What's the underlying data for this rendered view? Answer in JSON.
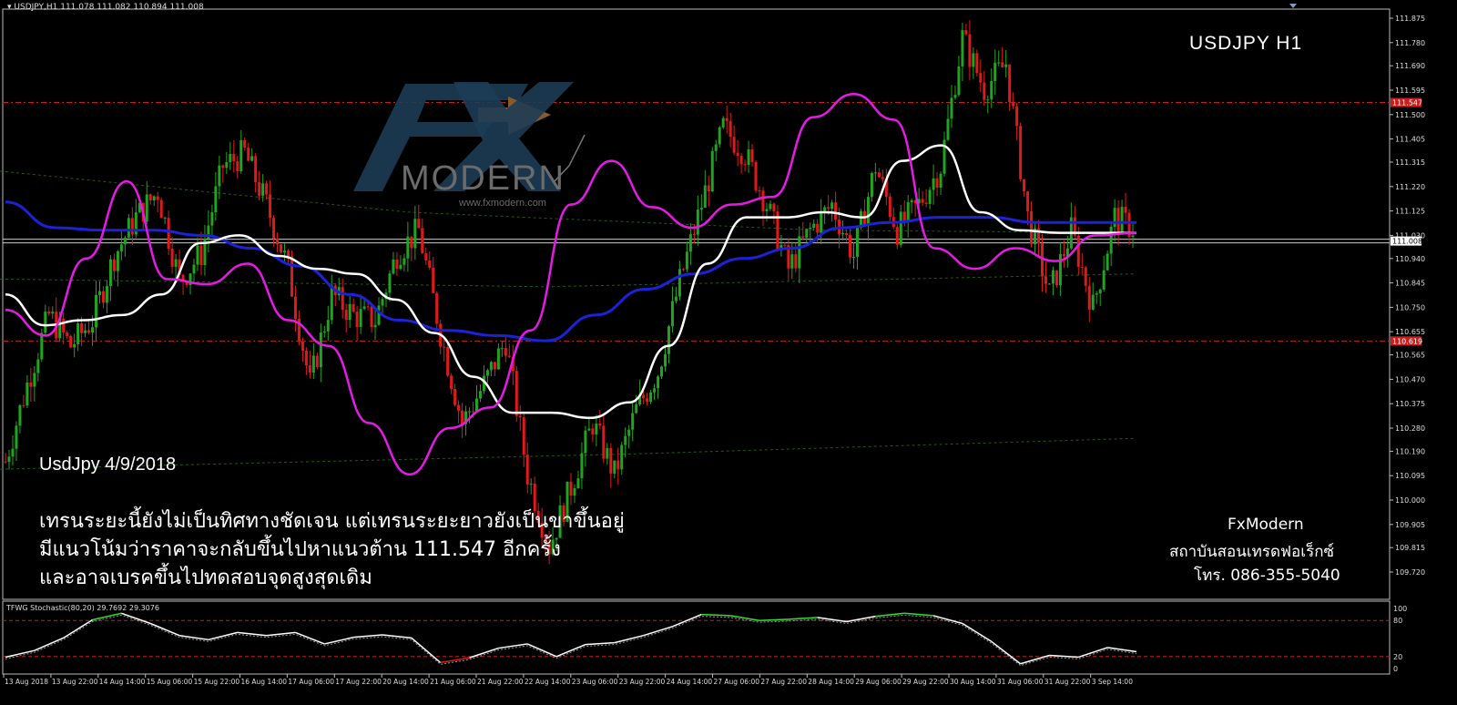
{
  "header": {
    "symbol_line": "USDJPY,H1  111.078 111.082 110.894 111.008",
    "corner_title": "USDJPY H1"
  },
  "annotation": {
    "date": "UsdJpy 4/9/2018",
    "lines": [
      "เทรนระยะนี้ยังไม่เป็นทิศทางชัดเจน แต่เทรนระยะยาวยังเป็นขาขึ้นอยู่",
      "มีแนวโน้มว่าราคาจะกลับขึ้นไปหาแนวต้าน 111.547 อีกครั้ง",
      "และอาจเบรคขึ้นไปทดสอบจุดสูงสุดเดิม"
    ]
  },
  "brand": {
    "name": "FxModern",
    "subtitle": "สถาบันสอนเทรดฟอเร็กซ์",
    "phone": "โทร. 086-355-5040",
    "logo_text": "MODERN",
    "logo_url": "www.fxmodern.com"
  },
  "indicator": {
    "label": "TFWG Stochastic(80,20) 29.7692 29.3076",
    "levels": [
      "100",
      "80",
      "20",
      "0"
    ]
  },
  "colors": {
    "bull": "#1fa51f",
    "bear": "#e01a1a",
    "slow_ma": "#1c22d8",
    "mid_ma": "#ffffff",
    "fast_ma": "#e51be5",
    "level_line": "#c81e1e",
    "stoch_up": "#33dd33",
    "stoch_down": "#e01a1a"
  },
  "chart_data": {
    "type": "line",
    "symbol": "USDJPY",
    "timeframe": "H1",
    "ylim": [
      109.72,
      111.875
    ],
    "y_ticks": [
      "111.875",
      "111.780",
      "111.690",
      "111.595",
      "111.500",
      "111.405",
      "111.315",
      "111.220",
      "111.125",
      "111.030",
      "110.940",
      "110.845",
      "110.750",
      "110.655",
      "110.565",
      "110.470",
      "110.375",
      "110.280",
      "110.190",
      "110.095",
      "110.000",
      "109.905",
      "109.815",
      "109.720"
    ],
    "price_tags": [
      "111.547",
      "110.619",
      "111.008"
    ],
    "x_tick_labels": [
      "13 Aug 2018",
      "13 Aug 22:00",
      "14 Aug 14:00",
      "15 Aug 06:00",
      "15 Aug 22:00",
      "16 Aug 14:00",
      "17 Aug 06:00",
      "17 Aug 22:00",
      "20 Aug 14:00",
      "21 Aug 06:00",
      "21 Aug 22:00",
      "22 Aug 14:00",
      "23 Aug 06:00",
      "23 Aug 22:00",
      "24 Aug 14:00",
      "27 Aug 06:00",
      "27 Aug 22:00",
      "28 Aug 14:00",
      "29 Aug 06:00",
      "29 Aug 22:00",
      "30 Aug 14:00",
      "31 Aug 06:00",
      "31 Aug 22:00",
      "3 Sep 14:00"
    ],
    "levels": [
      111.547,
      110.619
    ],
    "last_price": 111.008,
    "candle_close_path": [
      110.15,
      110.45,
      110.72,
      110.6,
      110.7,
      110.95,
      111.1,
      111.2,
      110.85,
      110.96,
      111.3,
      111.35,
      111.15,
      110.9,
      110.45,
      110.8,
      110.72,
      110.7,
      110.96,
      111.05,
      110.65,
      110.3,
      110.45,
      110.62,
      110.1,
      109.82,
      110.05,
      110.3,
      110.1,
      110.35,
      110.5,
      110.85,
      111.15,
      111.45,
      111.35,
      111.15,
      110.9,
      111.05,
      111.15,
      110.95,
      111.3,
      111.05,
      111.15,
      111.3,
      111.8,
      111.6,
      111.7,
      111.1,
      110.8,
      111.05,
      110.75,
      111.1,
      111.05
    ],
    "series": [
      {
        "name": "",
        "values": [
          110.8,
          110.68,
          110.7,
          110.72,
          110.8,
          111.0,
          111.03,
          110.95,
          110.9,
          110.88,
          110.78,
          110.65,
          110.48,
          110.34,
          110.34,
          110.32,
          110.38,
          110.6,
          110.92,
          111.1,
          111.1,
          111.12,
          111.1,
          111.32,
          111.38,
          111.12,
          111.05,
          111.04,
          111.04,
          111.04
        ]
      },
      {
        "name": "",
        "values": [
          110.74,
          110.64,
          110.94,
          111.24,
          110.86,
          110.84,
          110.92,
          110.7,
          110.6,
          110.3,
          110.1,
          110.28,
          110.36,
          110.66,
          111.15,
          111.32,
          111.14,
          111.06,
          111.15,
          111.18,
          111.49,
          111.58,
          111.48,
          110.98,
          110.9,
          110.98,
          110.93,
          111.03,
          111.04
        ]
      },
      {
        "name": "",
        "values": [
          111.16,
          111.06,
          111.05,
          111.05,
          111.03,
          110.98,
          110.91,
          110.8,
          110.7,
          110.66,
          110.64,
          110.62,
          110.72,
          110.82,
          110.88,
          110.94,
          110.98,
          111.06,
          111.08,
          111.1,
          111.1,
          111.08,
          111.08,
          111.08
        ]
      }
    ],
    "stochastic": {
      "values": [
        19,
        30,
        51,
        81,
        92,
        75,
        55,
        48,
        60,
        55,
        60,
        41,
        52,
        56,
        51,
        10,
        18,
        34,
        41,
        20,
        40,
        43,
        55,
        70,
        90,
        88,
        80,
        82,
        85,
        78,
        87,
        92,
        88,
        75,
        45,
        8,
        22,
        19,
        35,
        28
      ]
    }
  }
}
